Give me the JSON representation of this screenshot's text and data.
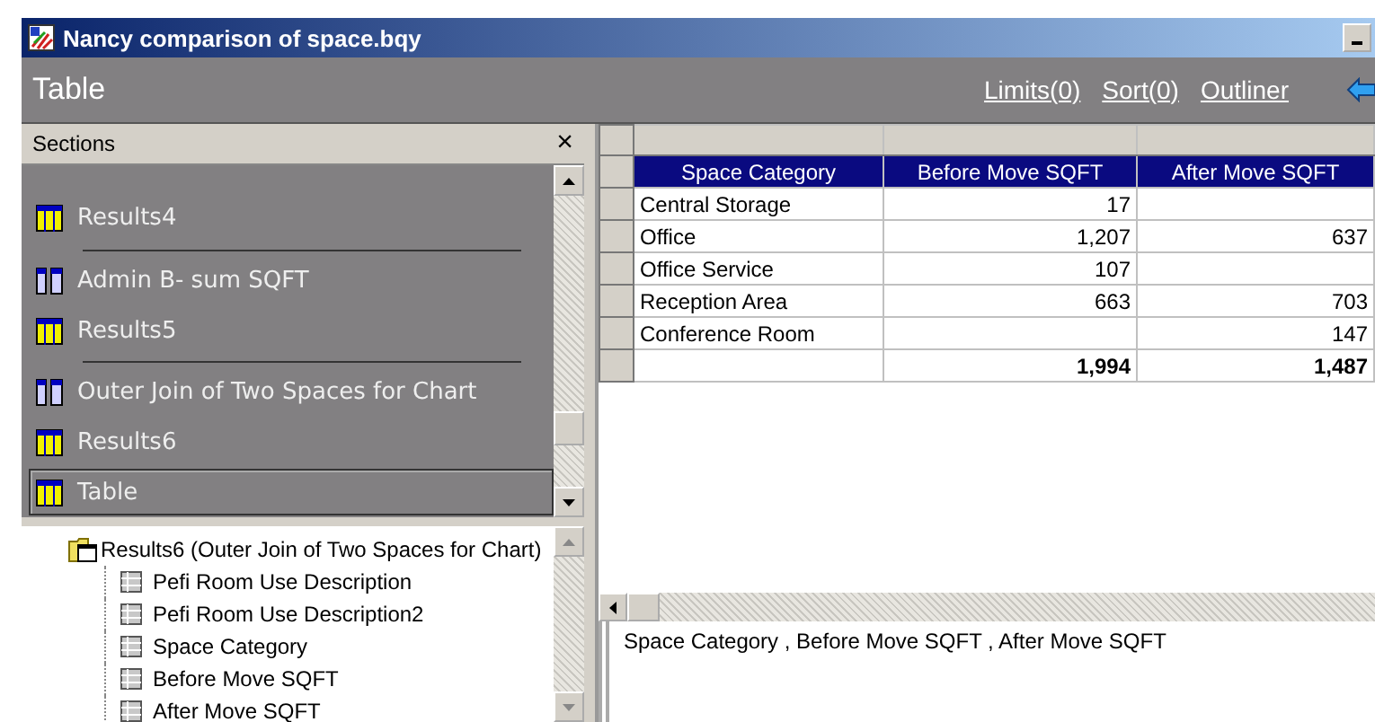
{
  "window": {
    "title": "Nancy comparison of space.bqy"
  },
  "toolbar": {
    "title": "Table",
    "links": [
      "Limits(0)",
      "Sort(0)",
      "Outliner"
    ]
  },
  "sections": {
    "title": "Sections",
    "close": "×",
    "items": [
      {
        "kind": "table",
        "label": "Results4",
        "selected": false
      },
      {
        "kind": "separator"
      },
      {
        "kind": "query",
        "label": "Admin B- sum SQFT",
        "selected": false
      },
      {
        "kind": "table",
        "label": "Results5",
        "selected": false
      },
      {
        "kind": "separator"
      },
      {
        "kind": "query",
        "label": "Outer Join of Two Spaces for Chart",
        "selected": false
      },
      {
        "kind": "table",
        "label": "Results6",
        "selected": false
      },
      {
        "kind": "table",
        "label": "Table",
        "selected": true
      }
    ]
  },
  "tree": {
    "label": "Results6 (Outer Join of Two Spaces for Chart)",
    "children": [
      {
        "label": "Pefi Room Use Description"
      },
      {
        "label": "Pefi Room Use Description2"
      },
      {
        "label": "Space Category"
      },
      {
        "label": "Before Move SQFT"
      },
      {
        "label": "After Move SQFT"
      }
    ]
  },
  "table": {
    "columns": [
      "Space Category",
      "Before Move SQFT",
      "After Move SQFT"
    ],
    "rows": [
      [
        "Central Storage",
        "17",
        ""
      ],
      [
        "Office",
        "1,207",
        "637"
      ],
      [
        "Office Service",
        "107",
        ""
      ],
      [
        "Reception Area",
        "663",
        "703"
      ],
      [
        "Conference Room",
        "",
        "147"
      ]
    ],
    "totals": {
      "column_2": "1,994",
      "column_3": "1,487"
    }
  },
  "column_list": "Space Category , Before Move SQFT , After Move SQFT"
}
